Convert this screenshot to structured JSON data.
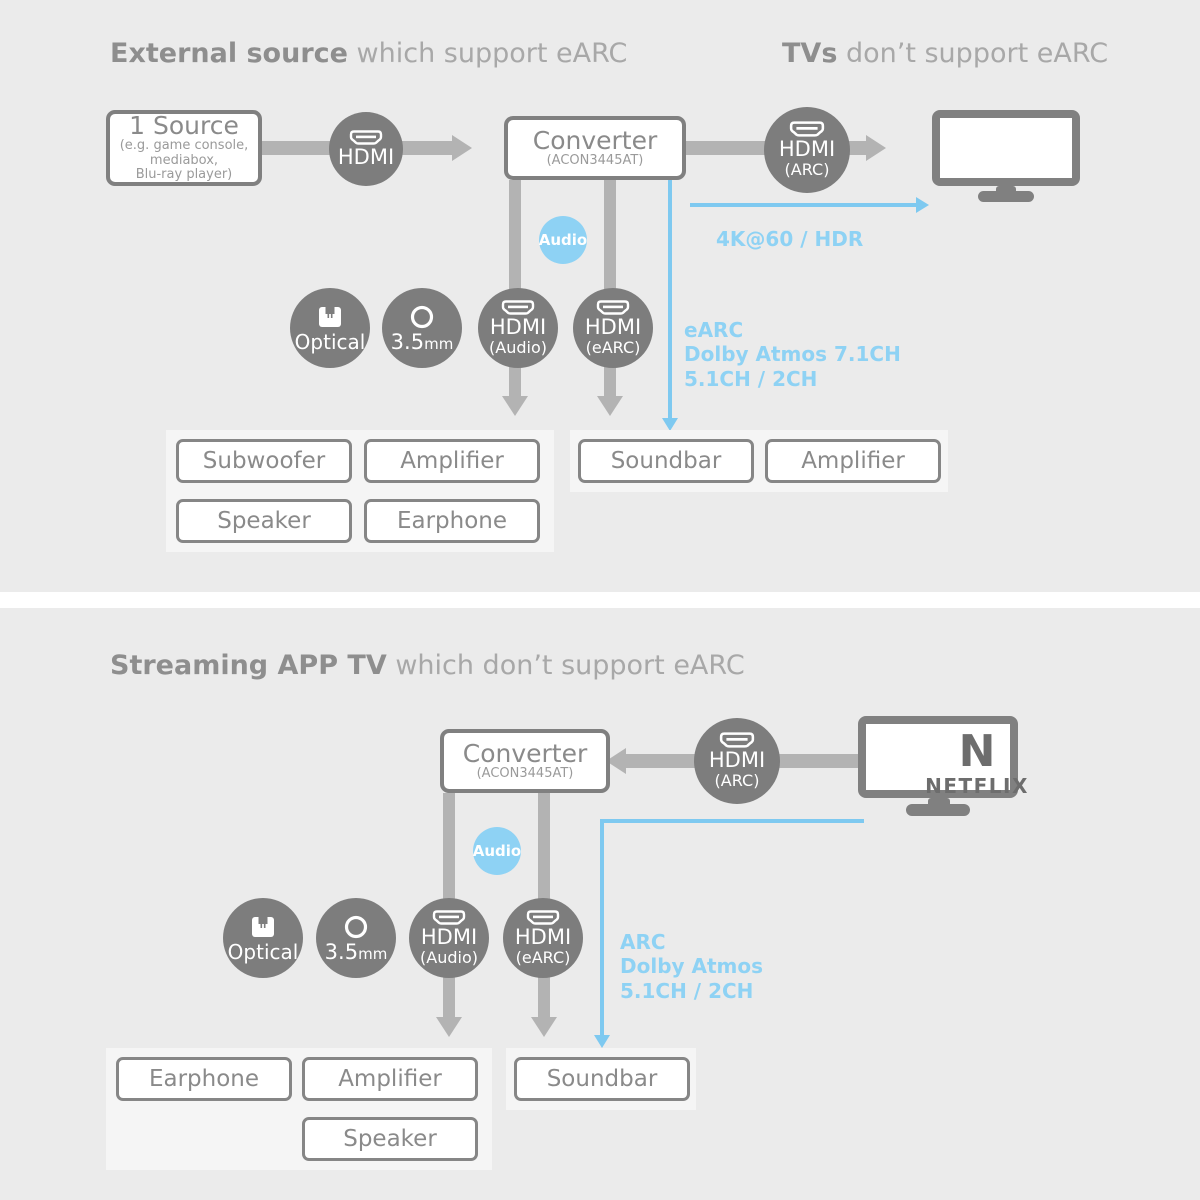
{
  "sections": [
    {
      "id": "external-source",
      "header": {
        "bold": "External source",
        "normal": " which support eARC"
      },
      "header_right": {
        "bold": "TVs",
        "normal": " don’t support eARC"
      },
      "source": {
        "title": "1 Source",
        "detail": "(e.g. game console,\nmediabox,\nBlu-ray player)"
      },
      "converter": {
        "title": "Converter",
        "model": "(ACON3445AT)"
      },
      "link_in": {
        "label": "HDMI",
        "sub": ""
      },
      "link_out": {
        "label": "HDMI",
        "sub": "(ARC)"
      },
      "audio_badge": "Audio",
      "ports": [
        {
          "label": "Optical",
          "sub": "",
          "icon": "optical-port-icon"
        },
        {
          "label": "3.5",
          "unit": "mm",
          "sub": "",
          "icon": "jack-port-icon"
        },
        {
          "label": "HDMI",
          "sub": "(Audio)",
          "icon": "hdmi-port-icon"
        },
        {
          "label": "HDMI",
          "sub": "(eARC)",
          "icon": "hdmi-port-icon"
        }
      ],
      "video_label": "4K@60 / HDR",
      "audio_label": "eARC\nDolby Atmos 7.1CH\n5.1CH / 2CH",
      "audio_label_lines": [
        "eARC",
        "Dolby Atmos 7.1CH",
        "5.1CH / 2CH"
      ],
      "outputs_left": [
        "Subwoofer",
        "Amplifier",
        "Speaker",
        "Earphone"
      ],
      "outputs_right": [
        "Soundbar",
        "Amplifier"
      ]
    },
    {
      "id": "streaming-app-tv",
      "header": {
        "bold": "Streaming APP TV",
        "normal": " which don’t support eARC"
      },
      "converter": {
        "title": "Converter",
        "model": "(ACON3445AT)"
      },
      "link_in": {
        "label": "HDMI",
        "sub": "(ARC)"
      },
      "audio_badge": "Audio",
      "tv_brand": {
        "mark": "N",
        "name": "NETFLIX"
      },
      "ports": [
        {
          "label": "Optical",
          "sub": "",
          "icon": "optical-port-icon"
        },
        {
          "label": "3.5",
          "unit": "mm",
          "sub": "",
          "icon": "jack-port-icon"
        },
        {
          "label": "HDMI",
          "sub": "(Audio)",
          "icon": "hdmi-port-icon"
        },
        {
          "label": "HDMI",
          "sub": "(eARC)",
          "icon": "hdmi-port-icon"
        }
      ],
      "audio_label_lines": [
        "ARC",
        "Dolby Atmos",
        "5.1CH / 2CH"
      ],
      "outputs_left": [
        "Earphone",
        "Amplifier",
        "Speaker"
      ],
      "outputs_right": [
        "Soundbar"
      ]
    }
  ],
  "colors": {
    "panel_bg": "#ebebeb",
    "tray_bg": "#f5f5f5",
    "gray_line": "#b3b3b3",
    "gray_stroke": "#808080",
    "circle_fill": "#7d7d7d",
    "blue": "#8ed2f4",
    "blue_line": "#7ec9f0",
    "text_gray": "#8a8a8a"
  }
}
